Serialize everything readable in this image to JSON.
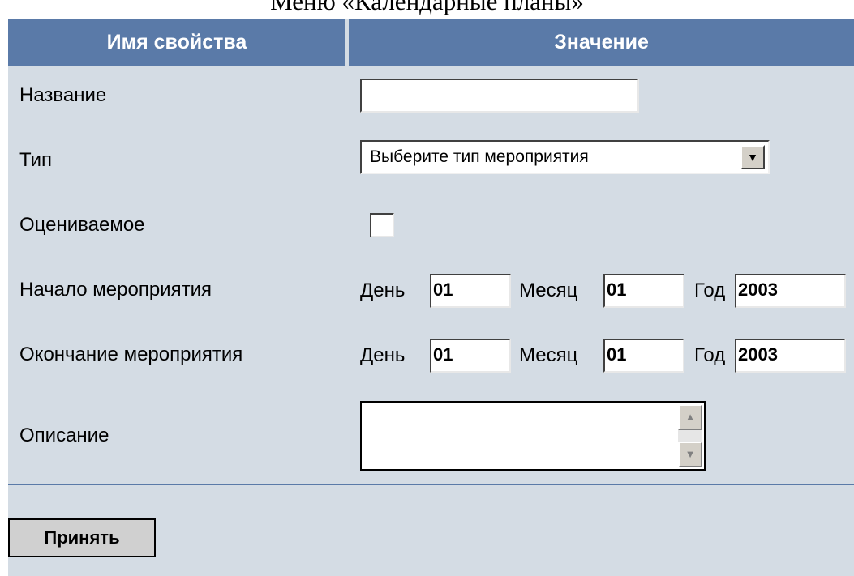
{
  "caption": "Меню «Календарные планы»",
  "colors": {
    "header_bg": "#5a7aa8",
    "panel_bg": "#d4dce4"
  },
  "table": {
    "header_name": "Имя свойства",
    "header_value": "Значение"
  },
  "fields": {
    "name": {
      "label": "Название",
      "value": ""
    },
    "type": {
      "label": "Тип",
      "selected": "Выберите тип мероприятия"
    },
    "graded": {
      "label": "Оцениваемое",
      "checked": false
    },
    "start": {
      "label": "Начало мероприятия",
      "day_label": "День",
      "day": "01",
      "month_label": "Месяц",
      "month": "01",
      "year_label": "Год",
      "year": "2003"
    },
    "end": {
      "label": "Окончание мероприятия",
      "day_label": "День",
      "day": "01",
      "month_label": "Месяц",
      "month": "01",
      "year_label": "Год",
      "year": "2003"
    },
    "description": {
      "label": "Описание",
      "value": ""
    }
  },
  "icons": {
    "dropdown": "chevron-down-icon",
    "scroll_up": "scroll-up-icon",
    "scroll_down": "scroll-down-icon"
  },
  "submit_label": "Принять"
}
